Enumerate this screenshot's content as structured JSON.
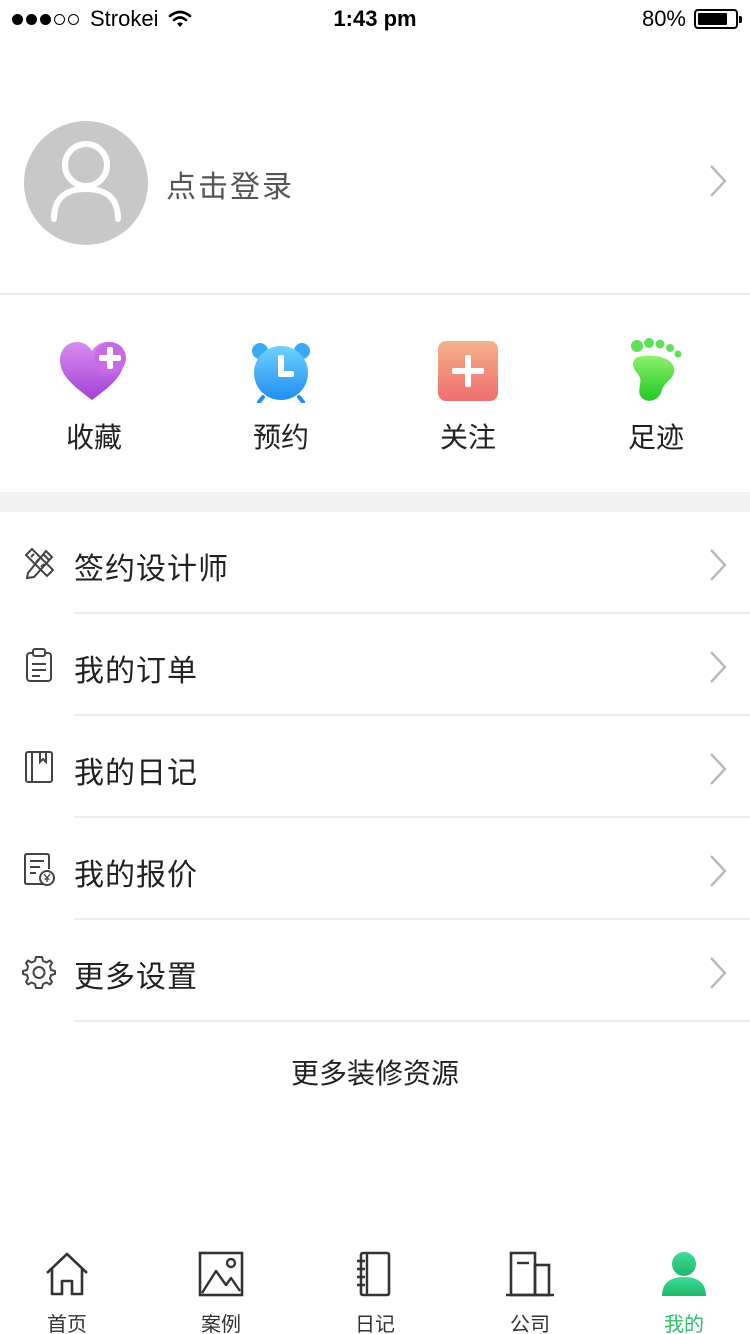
{
  "status_bar": {
    "carrier": "Strokei",
    "time": "1:43 pm",
    "battery": "80%",
    "battery_level": 0.8
  },
  "profile": {
    "login_text": "点击登录"
  },
  "shortcuts": [
    {
      "label": "收藏",
      "icon": "favorite-heart-icon"
    },
    {
      "label": "预约",
      "icon": "alarm-clock-icon"
    },
    {
      "label": "关注",
      "icon": "plus-follow-icon"
    },
    {
      "label": "足迹",
      "icon": "footprint-icon"
    }
  ],
  "menu": [
    {
      "label": "签约设计师",
      "icon": "pencil-ruler-icon"
    },
    {
      "label": "我的订单",
      "icon": "clipboard-icon"
    },
    {
      "label": "我的日记",
      "icon": "notebook-icon"
    },
    {
      "label": "我的报价",
      "icon": "quote-document-icon"
    },
    {
      "label": "更多设置",
      "icon": "gear-icon"
    }
  ],
  "more_resources": "更多装修资源",
  "tab_bar": {
    "tabs": [
      {
        "label": "首页",
        "icon": "home-icon"
      },
      {
        "label": "案例",
        "icon": "picture-icon"
      },
      {
        "label": "日记",
        "icon": "diary-icon"
      },
      {
        "label": "公司",
        "icon": "building-icon"
      },
      {
        "label": "我的",
        "icon": "user-icon"
      }
    ],
    "active_index": 4
  },
  "colors": {
    "accent_green": "#2bc06e",
    "divider": "#ececec",
    "band": "#f2f2f2",
    "avatar_bg": "#c8c8c8"
  }
}
